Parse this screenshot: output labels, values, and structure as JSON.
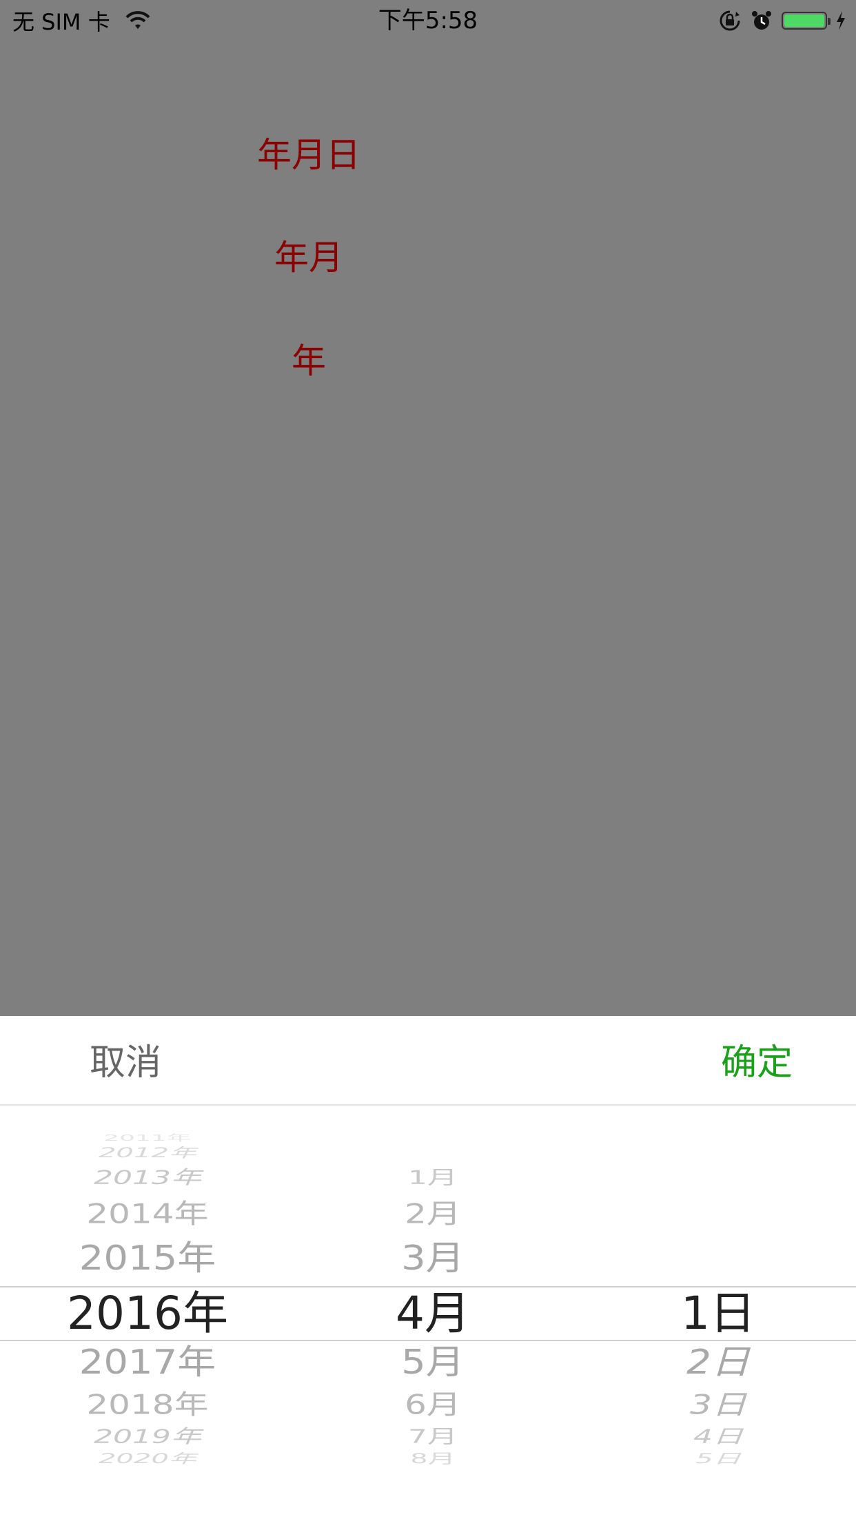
{
  "status_bar": {
    "carrier": "无 SIM 卡",
    "time": "下午5:58",
    "battery_color": "#4cd964"
  },
  "options": [
    {
      "label": "年月日"
    },
    {
      "label": "年月"
    },
    {
      "label": "年"
    }
  ],
  "picker": {
    "cancel_label": "取消",
    "confirm_label": "确定",
    "confirm_color": "#1ca01c",
    "years": {
      "up": [
        "2011年",
        "2012年",
        "2013年",
        "2014年",
        "2015年"
      ],
      "selected": "2016年",
      "down": [
        "2017年",
        "2018年",
        "2019年",
        "2020年"
      ]
    },
    "months": {
      "up": [
        "1月",
        "2月",
        "3月"
      ],
      "selected": "4月",
      "down": [
        "5月",
        "6月",
        "7月",
        "8月"
      ]
    },
    "days": {
      "selected": "1日",
      "down": [
        "2日",
        "3日",
        "4日",
        "5日"
      ]
    }
  }
}
